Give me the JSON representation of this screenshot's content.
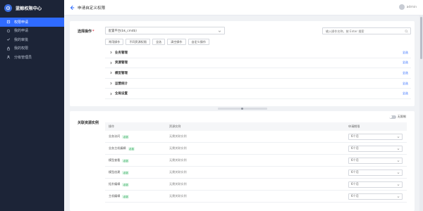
{
  "sidebar": {
    "brand": "蓝鲸权限中心",
    "items": [
      {
        "label": "权限申请",
        "icon": "apply-icon",
        "active": true
      },
      {
        "label": "我的申请",
        "icon": "my-apply-icon",
        "active": false
      },
      {
        "label": "我的审批",
        "icon": "approval-icon",
        "active": false
      },
      {
        "label": "我的权限",
        "icon": "my-perm-icon",
        "active": false
      },
      {
        "label": "分级管理员",
        "icon": "grade-admin-icon",
        "active": false
      }
    ]
  },
  "header": {
    "title": "申请自定义权限",
    "user": "admin"
  },
  "form": {
    "ops_label": "选择操作",
    "system_select_value": "配置平台(bk_cmdb)",
    "search_placeholder": "输入操作名称，按 Enter 搜索",
    "tabs": [
      "常用操作",
      "不同资源权限",
      "全选",
      "清空操作",
      "自定义操作"
    ],
    "modules": [
      {
        "name": "业务管理",
        "action": "全选"
      },
      {
        "name": "资源管理",
        "action": "全选"
      },
      {
        "name": "模型管理",
        "action": "全选"
      },
      {
        "name": "运营统计",
        "action": "全选"
      },
      {
        "name": "全局设置",
        "action": "全选"
      }
    ]
  },
  "assoc": {
    "label": "关联资源实例",
    "toggle_label": "无限制",
    "columns": [
      "操作",
      "资源实例",
      "申请期限"
    ],
    "rows": [
      {
        "op": "业务访问",
        "tag": "必选",
        "resource": "无需关联实例",
        "duration": "6个月"
      },
      {
        "op": "业务主机编辑",
        "tag": "必选",
        "resource": "无需关联实例",
        "duration": "6个月"
      },
      {
        "op": "模型查看",
        "tag": "必选",
        "resource": "无需关联实例",
        "duration": "6个月"
      },
      {
        "op": "模型创建",
        "tag": "必选",
        "resource": "无需关联实例",
        "duration": "6个月"
      },
      {
        "op": "拓扑编辑",
        "tag": "必选",
        "resource": "无需关联实例",
        "duration": "6个月"
      },
      {
        "op": "主机编辑",
        "tag": "必选",
        "resource": "无需关联实例",
        "duration": "6个月"
      }
    ]
  },
  "colors": {
    "accent": "#2f6bff",
    "sidebar_bg": "#1c2437",
    "page_bg": "#f0f2f5"
  }
}
